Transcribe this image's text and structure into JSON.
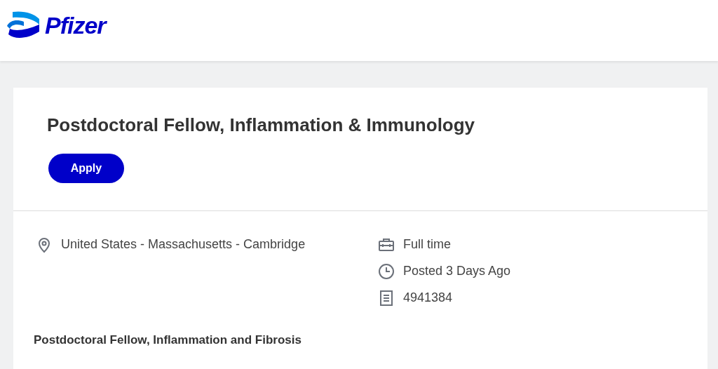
{
  "header": {
    "logo_text": "Pfizer"
  },
  "job": {
    "title": "Postdoctoral Fellow, Inflammation & Immunology",
    "apply_button": "Apply",
    "location": "United States - Massachusetts - Cambridge",
    "details": [
      {
        "kind": "time_type",
        "text": "Full time"
      },
      {
        "kind": "posted",
        "text": "Posted 3 Days Ago"
      },
      {
        "kind": "requisition",
        "text": "4941384"
      }
    ],
    "description_heading": "Postdoctoral Fellow, Inflammation and Fibrosis"
  }
}
